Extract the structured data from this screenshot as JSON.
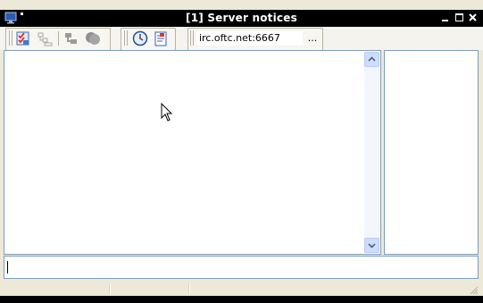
{
  "window": {
    "title": "[1] Server notices",
    "icon": "monitor-icon",
    "controls": [
      "minimize-icon",
      "maximize-icon",
      "close-icon"
    ]
  },
  "toolbar": {
    "buttons": [
      {
        "name": "options",
        "icon": "checklist-icon",
        "enabled": true
      },
      {
        "name": "channel-list",
        "icon": "list-icon",
        "enabled": false
      },
      {
        "name": "network",
        "icon": "network-icon",
        "enabled": false
      },
      {
        "name": "chat",
        "icon": "bubbles-icon",
        "enabled": false
      },
      {
        "name": "timestamps",
        "icon": "clock-icon",
        "enabled": true
      },
      {
        "name": "channel-log",
        "icon": "log-icon",
        "enabled": true
      }
    ],
    "server": {
      "value": "irc.oftc.net:6667",
      "more_label": "..."
    }
  },
  "colors": {
    "titlebar": "#000000",
    "panel_border": "#7f9db9",
    "scrollbar_track": "#f3f6fd",
    "scroll_arrow": "#cddcf8"
  }
}
